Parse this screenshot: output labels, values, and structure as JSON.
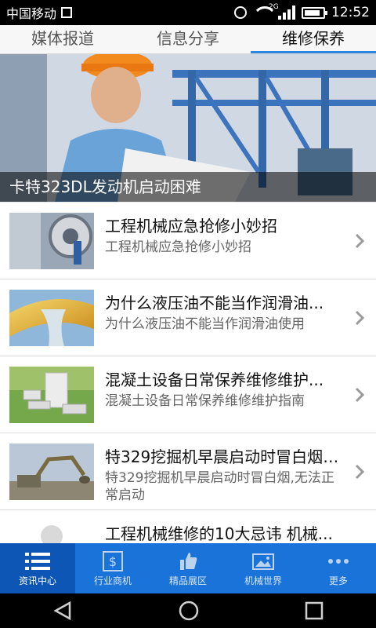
{
  "status": {
    "carrier": "中国移动",
    "network_label": "2G",
    "time": "12:52"
  },
  "tabs": [
    {
      "label": "媒体报道",
      "active": false
    },
    {
      "label": "信息分享",
      "active": false
    },
    {
      "label": "维修保养",
      "active": true
    }
  ],
  "banner": {
    "caption": "卡特323DL发动机启动困难"
  },
  "list": [
    {
      "title": "工程机械应急抢修小妙招",
      "subtitle": "工程机械应急抢修小妙招"
    },
    {
      "title": "为什么液压油不能当作润滑油...",
      "subtitle": "为什么液压油不能当作润滑油使用"
    },
    {
      "title": "混凝土设备日常保养维修维护...",
      "subtitle": "混凝土设备日常保养维修维护指南"
    },
    {
      "title": "特329挖掘机早晨启动时冒白烟,...",
      "subtitle": "特329挖掘机早晨启动时冒白烟,无法正常启动"
    },
    {
      "title": "工程机械维修的10大忌讳 机械...",
      "subtitle": ""
    }
  ],
  "bottom_nav": [
    {
      "label": "资讯中心",
      "icon": "list-icon",
      "active": true
    },
    {
      "label": "行业商机",
      "icon": "dollar-icon",
      "active": false
    },
    {
      "label": "精品展区",
      "icon": "thumbs-up-icon",
      "active": false
    },
    {
      "label": "机械世界",
      "icon": "picture-icon",
      "active": false
    },
    {
      "label": "更多",
      "icon": "more-icon",
      "active": false
    }
  ],
  "colors": {
    "accent": "#1a73d8",
    "active_tab_underline": "#2c86df"
  }
}
